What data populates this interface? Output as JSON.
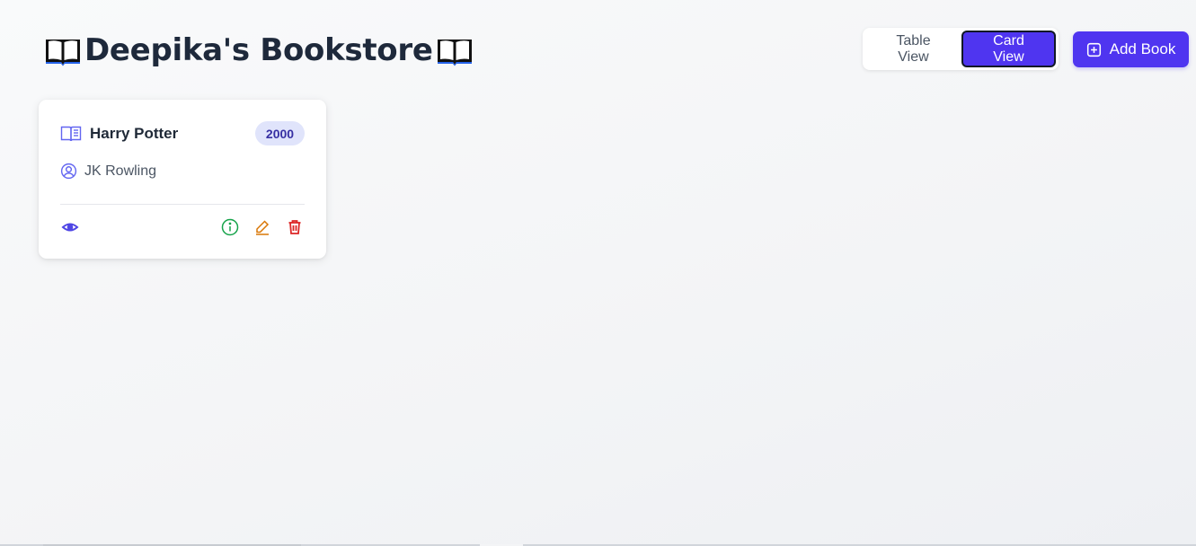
{
  "header": {
    "title": "Deepika's Bookstore",
    "title_icon": "open-book-emoji"
  },
  "view_toggle": {
    "table_label": "Table View",
    "card_label": "Card View",
    "active": "Card View"
  },
  "add_button": {
    "label": "Add Book",
    "icon": "plus-square-icon"
  },
  "books": [
    {
      "title": "Harry Potter",
      "year": "2000",
      "author": "JK Rowling"
    }
  ],
  "colors": {
    "accent": "#4f35f0",
    "badge_bg": "#e0e4fb",
    "badge_text": "#3730a3",
    "view_icon": "#4f46e5",
    "info_icon": "#16a34a",
    "edit_icon": "#d97706",
    "delete_icon": "#dc2626"
  }
}
